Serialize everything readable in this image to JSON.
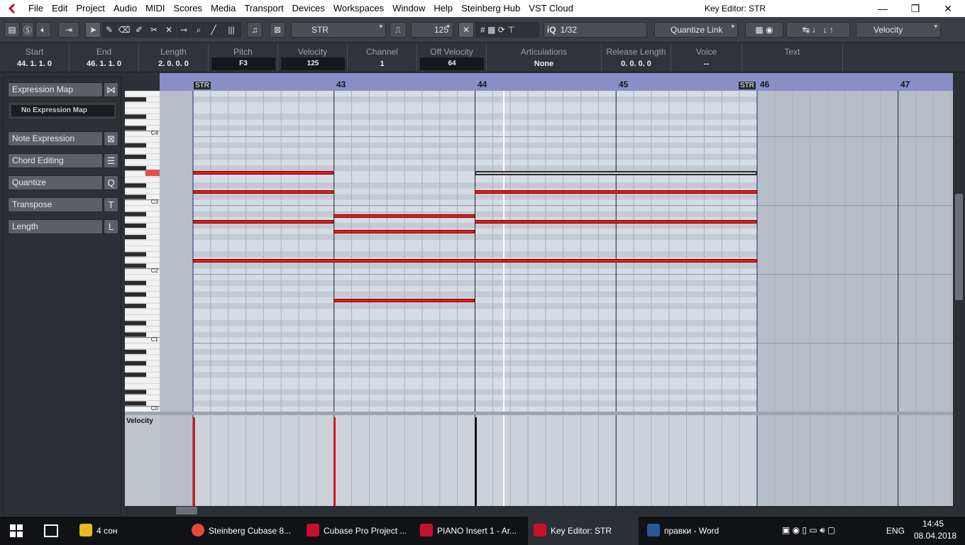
{
  "menubar": {
    "items": [
      "File",
      "Edit",
      "Project",
      "Audio",
      "MIDI",
      "Scores",
      "Media",
      "Transport",
      "Devices",
      "Workspaces",
      "Window",
      "Help",
      "Steinberg Hub",
      "VST Cloud"
    ],
    "window_title": "Key Editor: STR",
    "minimize": "—",
    "maximize": "❐",
    "close": "✕"
  },
  "toolbar": {
    "track_name": "STR",
    "velocity_value": "125",
    "quantize_icon_label": "iQ",
    "quantize_value": "1/32",
    "quantize_link": "Quantize Link",
    "controller_lane": "Velocity"
  },
  "infoline": {
    "fields": [
      {
        "label": "Start",
        "value": "44.  1.  1.    0"
      },
      {
        "label": "End",
        "value": "46.  1.  1.    0"
      },
      {
        "label": "Length",
        "value": "2.  0.  0.    0"
      },
      {
        "label": "Pitch",
        "value": "F3"
      },
      {
        "label": "Velocity",
        "value": "125"
      },
      {
        "label": "Channel",
        "value": "1"
      },
      {
        "label": "Off Velocity",
        "value": "64"
      },
      {
        "label": "Articulations",
        "value": "None"
      },
      {
        "label": "Release Length",
        "value": "0.  0.  0.    0"
      },
      {
        "label": "Voice",
        "value": "--"
      },
      {
        "label": "Text",
        "value": ""
      }
    ]
  },
  "inspector": {
    "expression_map": "Expression Map",
    "expression_map_value": "No Expression Map",
    "note_expression": "Note Expression",
    "chord_editing": "Chord Editing",
    "quantize": "Quantize",
    "quantize_key": "Q",
    "transpose": "Transpose",
    "transpose_key": "T",
    "length": "Length",
    "length_key": "L"
  },
  "ruler": {
    "bars": [
      "43",
      "44",
      "45",
      "46",
      "47"
    ],
    "part_label": "STR"
  },
  "keyboard": {
    "octave_labels": [
      "C4",
      "C3",
      "C2",
      "C1",
      "C0"
    ]
  },
  "velocity_lane": {
    "label": "Velocity"
  },
  "note_data": {
    "selected_note": {
      "pitch": "F3",
      "start": "44.1.1.0",
      "end": "46.1.1.0",
      "velocity": 125
    }
  },
  "taskbar": {
    "items": [
      {
        "label": "4 сон",
        "color": "#e8b923"
      },
      {
        "label": "Steinberg Cubase 8...",
        "color": "#e04a3b"
      },
      {
        "label": "Cubase Pro Project ...",
        "color": "#c8102e"
      },
      {
        "label": "PIANO Insert 1 - Ar...",
        "color": "#c8102e"
      },
      {
        "label": "Key Editor: STR",
        "color": "#c8102e"
      },
      {
        "label": "правки - Word",
        "color": "#2b5797"
      }
    ],
    "lang": "ENG",
    "time": "14:45",
    "date": "08.04.2018"
  }
}
